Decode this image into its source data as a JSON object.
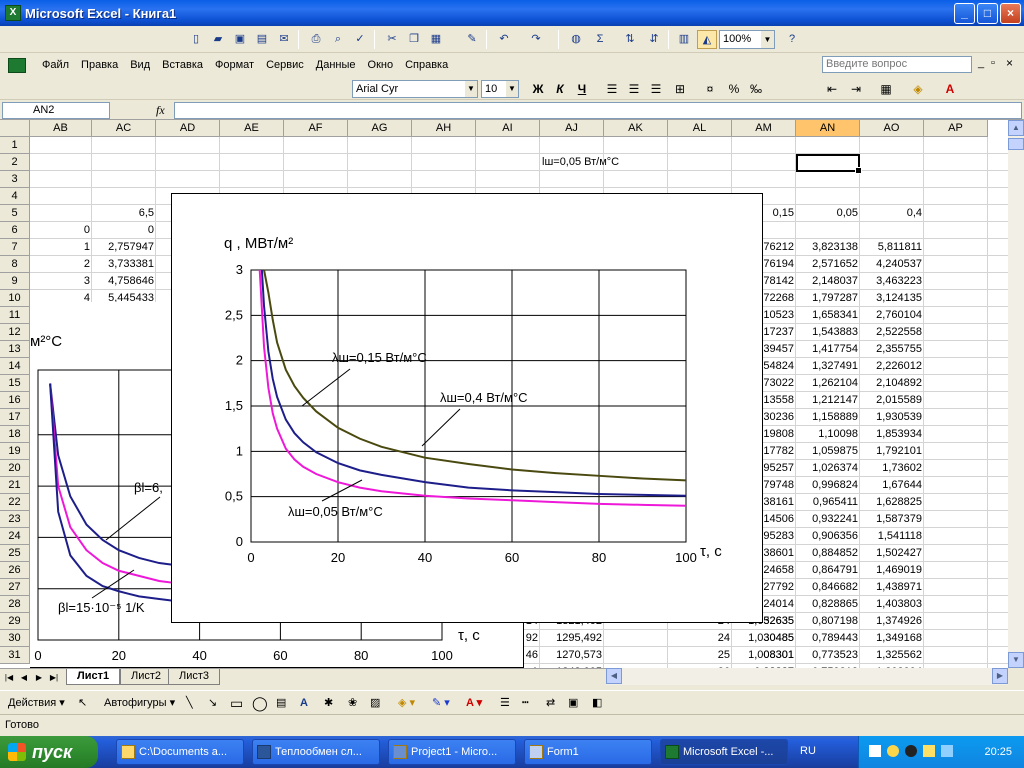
{
  "window": {
    "title": "Microsoft Excel - Книга1",
    "icon": "excel-icon",
    "minimize": "_",
    "maximize": "□",
    "close": "×"
  },
  "menu": {
    "items": [
      "Файл",
      "Правка",
      "Вид",
      "Вставка",
      "Формат",
      "Сервис",
      "Данные",
      "Окно",
      "Справка"
    ],
    "help_placeholder": "Введите вопрос"
  },
  "toolbar": {
    "zoom": "100%"
  },
  "format": {
    "font": "Arial Cyr",
    "size": "10",
    "bold": "Ж",
    "italic": "К",
    "underline": "Ч",
    "percent": "%"
  },
  "formula": {
    "namebox": "AN2",
    "fx": "fx",
    "value": ""
  },
  "columns": [
    "AB",
    "AC",
    "AD",
    "AE",
    "AF",
    "AG",
    "AH",
    "AI",
    "AJ",
    "AK",
    "AL",
    "AM",
    "AN",
    "AO",
    "AP"
  ],
  "rows": [
    "1",
    "2",
    "3",
    "4",
    "5",
    "6",
    "7",
    "8",
    "9",
    "10",
    "11",
    "12",
    "13",
    "14",
    "15",
    "16",
    "17",
    "18",
    "19",
    "20",
    "21",
    "22",
    "23",
    "24",
    "25",
    "26",
    "27",
    "28",
    "29",
    "30",
    "31"
  ],
  "cells": {
    "aj2": "lш=0,05 Вт/м°С",
    "ac5": "6,5",
    "ab_vals": [
      "0",
      "1",
      "2",
      "3",
      "4"
    ],
    "ac_vals": [
      "0",
      "2,757947",
      "3,733381",
      "4,758646",
      "5,445433"
    ],
    "am5": "0,15",
    "an5": "0,05",
    "ao5": "0,4",
    "am_tail": [
      "76212",
      "76194",
      "78142",
      "72268",
      "10523",
      "17237",
      "39457",
      "54824",
      "73022",
      "13558",
      "30236",
      "19808",
      "17782",
      "95257",
      "79748",
      "38161",
      "14506",
      "95283",
      "38601",
      "24658",
      "27792",
      "24014",
      "32635",
      "30485",
      "08301",
      "09397"
    ],
    "an_vals": [
      "3,823138",
      "2,571652",
      "2,148037",
      "1,797287",
      "1,658341",
      "1,543883",
      "1,417754",
      "1,327491",
      "1,262104",
      "1,212147",
      "1,158889",
      "1,10098",
      "1,059875",
      "1,026374",
      "0,996824",
      "0,965411",
      "0,932241",
      "0,906356",
      "0,884852",
      "0,864791",
      "0,846682",
      "0,828865",
      "0,807198",
      "0,789443",
      "0,773523",
      "0,759318"
    ],
    "ao_vals": [
      "5,811811",
      "4,240537",
      "3,463223",
      "3,124135",
      "2,760104",
      "2,522558",
      "2,355755",
      "2,226012",
      "2,104892",
      "2,015589",
      "1,930539",
      "1,853934",
      "1,792101",
      "1,73602",
      "1,67644",
      "1,628825",
      "1,587379",
      "1,541118",
      "1,502427",
      "1,469019",
      "1,438971",
      "1,403803",
      "1,374926",
      "1,349168",
      "1,325562",
      "1,303994"
    ],
    "left_bottom": [
      {
        "a": "14",
        "b": "1321,402",
        "c": "24",
        "d": "1,052635"
      },
      {
        "a": "92",
        "b": "1295,492",
        "c": "24",
        "d": "1,030485"
      },
      {
        "a": "46",
        "b": "1270,573",
        "c": "25",
        "d": "1,008301"
      },
      {
        "a": "1",
        "b": "1248,005",
        "c": "26",
        "d": "0,98937"
      }
    ]
  },
  "sheets": [
    "Лист1",
    "Лист2",
    "Лист3"
  ],
  "drawing": {
    "actions": "Действия",
    "autoshapes": "Автофигуры"
  },
  "status": "Готово",
  "taskbar": {
    "start": "пуск",
    "tasks": [
      "C:\\Documents a...",
      "Теплообмен сл...",
      "Project1 - Micro...",
      "Form1",
      "Microsoft Excel -..."
    ],
    "lang": "RU",
    "clock": "20:25"
  },
  "chart_data": [
    {
      "type": "line",
      "ylabel": "q , МВт/м²",
      "xlabel": "τ, с",
      "xlim": [
        0,
        100
      ],
      "ylim": [
        0,
        3
      ],
      "xticks": [
        "0",
        "20",
        "40",
        "60",
        "80",
        "100"
      ],
      "yticks": [
        "0",
        "0,5",
        "1",
        "1,5",
        "2",
        "2,5",
        "3"
      ],
      "grid": true,
      "annotations": [
        "λш=0,15 Вт/м°С",
        "λш=0,4 Вт/м°С",
        "λш=0,05 Вт/м°С"
      ],
      "series": [
        {
          "name": "λш=0,4 Вт/м°С",
          "color": "#4a4a10",
          "x": [
            3,
            4,
            5,
            6,
            8,
            10,
            12,
            15,
            20,
            25,
            30,
            40,
            50,
            60,
            70,
            80,
            90,
            100
          ],
          "y": [
            3.0,
            2.75,
            2.45,
            2.2,
            1.9,
            1.72,
            1.59,
            1.44,
            1.26,
            1.14,
            1.05,
            0.93,
            0.86,
            0.8,
            0.76,
            0.73,
            0.7,
            0.68
          ]
        },
        {
          "name": "λш=0,15 Вт/м°С",
          "color": "#1e1e8a",
          "x": [
            2.5,
            3,
            4,
            5,
            6,
            8,
            10,
            12,
            15,
            20,
            25,
            30,
            40,
            50,
            60,
            70,
            80,
            90,
            100
          ],
          "y": [
            3.0,
            2.6,
            2.1,
            1.8,
            1.6,
            1.35,
            1.2,
            1.1,
            0.99,
            0.87,
            0.79,
            0.74,
            0.66,
            0.6,
            0.57,
            0.55,
            0.53,
            0.52,
            0.51
          ]
        },
        {
          "name": "λш=0,05 Вт/м°С",
          "color": "#ee18d8",
          "x": [
            2,
            3,
            4,
            5,
            6,
            8,
            10,
            12,
            15,
            20,
            25,
            30,
            40,
            50,
            60,
            70,
            80,
            90,
            100
          ],
          "y": [
            3.0,
            2.15,
            1.7,
            1.42,
            1.25,
            1.03,
            0.91,
            0.83,
            0.75,
            0.66,
            0.6,
            0.56,
            0.51,
            0.48,
            0.46,
            0.44,
            0.42,
            0.41,
            0.4
          ]
        }
      ]
    },
    {
      "type": "line",
      "ylabel": "м²°С",
      "xlabel": "τ, с",
      "xlim": [
        0,
        100
      ],
      "xticks": [
        "0",
        "20",
        "40",
        "60",
        "80",
        "100"
      ],
      "grid": true,
      "annotations": [
        "βl=6,",
        "βl=15·10⁻⁵ 1/K"
      ],
      "series": [
        {
          "color": "#1e1e8a",
          "x": [
            3,
            5,
            8,
            12,
            16,
            20,
            25,
            30,
            35
          ],
          "y": [
            1.0,
            0.72,
            0.56,
            0.45,
            0.39,
            0.35,
            0.32,
            0.3,
            0.29
          ]
        },
        {
          "color": "#ee18d8",
          "x": [
            3,
            5,
            8,
            12,
            16,
            20,
            25,
            30,
            35
          ],
          "y": [
            1.0,
            0.6,
            0.44,
            0.35,
            0.3,
            0.27,
            0.25,
            0.23,
            0.22
          ]
        },
        {
          "color": "#1e1e8a",
          "x": [
            3,
            5,
            8,
            12,
            16,
            20,
            25,
            30,
            35
          ],
          "y": [
            1.0,
            0.5,
            0.33,
            0.25,
            0.21,
            0.19,
            0.17,
            0.16,
            0.15
          ]
        }
      ]
    }
  ]
}
